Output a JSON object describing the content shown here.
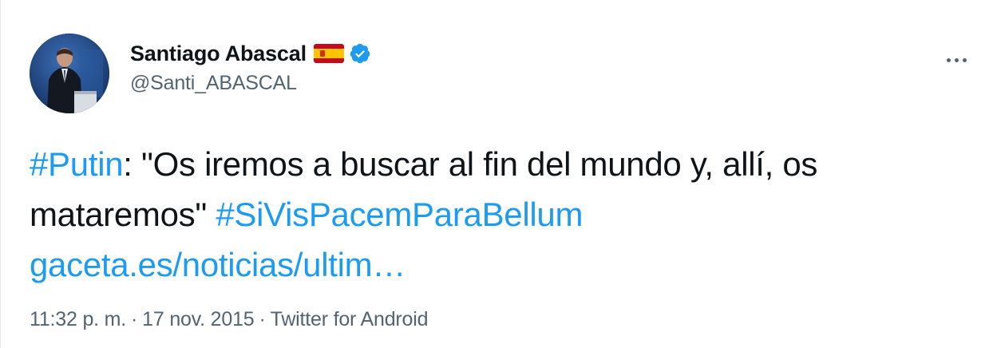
{
  "author": {
    "display_name": "Santiago Abascal",
    "handle": "@Santi_ABASCAL",
    "flag_icon": "spain-flag-emoji",
    "verified_icon": "verified-badge-icon",
    "verified_color": "#1d9bf0"
  },
  "more_icon": "more-horizontal-icon",
  "tweet": {
    "hashtag_putin": "#Putin",
    "text_quote": ": \"Os iremos a buscar al fin del mundo y, allí, os mataremos\" ",
    "hashtag_sivispacem": "#SiVisPacemParaBellum",
    "link_url": "gaceta.es/noticias/ultim…"
  },
  "meta": {
    "time": "11:32 p. m.",
    "separator": "·",
    "date": "17 nov. 2015",
    "source": "Twitter for Android"
  },
  "colors": {
    "link": "#1d9bf0",
    "text": "#0f1419",
    "secondary": "#536471"
  }
}
